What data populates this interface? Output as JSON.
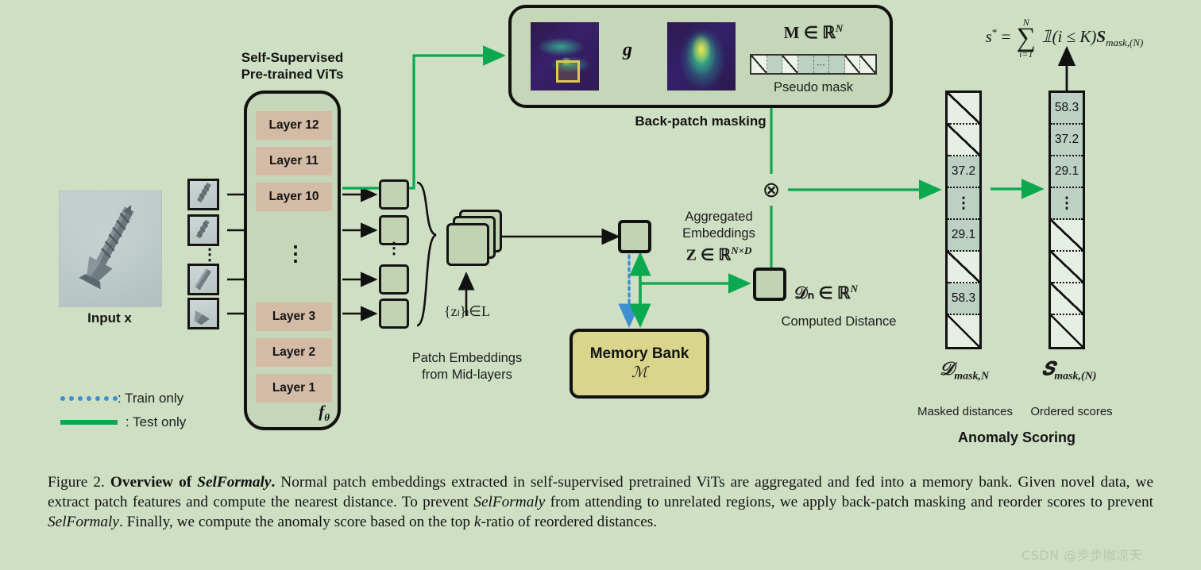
{
  "figure": {
    "background_color": "#cfdfc3",
    "accent_green": "#0aa84f",
    "train_blue": "#3d8fd0",
    "layer_color": "#d3bba6",
    "memory_bank_color": "#d9d68c"
  },
  "input": {
    "label": "Input x",
    "icon": "screw-photo"
  },
  "encoder": {
    "title_line1": "Self-Supervised",
    "title_line2": "Pre-trained ViTs",
    "layers": [
      {
        "label": "Layer 12"
      },
      {
        "label": "Layer 11"
      },
      {
        "label": "Layer 10"
      },
      {
        "label": "Layer 3"
      },
      {
        "label": "Layer 2"
      },
      {
        "label": "Layer 1"
      }
    ],
    "vertical_dots": "⋮",
    "function_symbol": "fθ"
  },
  "patch_embeddings": {
    "set_symbol": "{zₗ}ₗ∈L",
    "caption_line1": "Patch Embeddings",
    "caption_line2": "from Mid-layers"
  },
  "aggregated": {
    "caption_line1": "Aggregated",
    "caption_line2": "Embeddings",
    "math": "Z ∈ ℝ",
    "math_superscript": "N×D"
  },
  "memory_bank": {
    "title": "Memory Bank",
    "symbol": "ℳ"
  },
  "back_patch_masking": {
    "panel_title": "Back-patch masking",
    "transform_symbol": "g",
    "mask_math": "M ∈ ℝ",
    "mask_math_superscript": "N",
    "mask_caption": "Pseudo mask",
    "mask_cells": [
      "hatch",
      "shade",
      "hatch",
      "shade",
      "dots",
      "shade",
      "hatch",
      "hatch"
    ],
    "mask_dots": "⋯",
    "heatmap_left": "feature-heatmap-icon",
    "heatmap_right": "gaussian-heatmap-icon",
    "selection_box": "selected-patch-box"
  },
  "distance": {
    "math": "𝒟ₙ ∈ ℝ",
    "math_superscript": "N",
    "caption": "Computed Distance",
    "operator_symbol": "⊗"
  },
  "anomaly_scoring": {
    "section_title": "Anomaly Scoring",
    "formula": "s* = ∑ 𝟙(i ≤ K)𝑺mask,(N)",
    "formula_parts": {
      "lhs": "s",
      "star": "*",
      "eq": "=",
      "sum": "∑",
      "sum_upper": "N",
      "sum_lower": "i=1",
      "indicator": "𝟙(i ≤ K)",
      "term": "S",
      "term_sub": "mask,(N)"
    },
    "masked": {
      "symbol_main": "𝒟",
      "symbol_sub": "mask,N",
      "caption": "Masked distances",
      "cells": [
        {
          "type": "hatch",
          "value": ""
        },
        {
          "type": "hatch",
          "value": ""
        },
        {
          "type": "shade",
          "value": "37.2"
        },
        {
          "type": "dots",
          "value": "⋮"
        },
        {
          "type": "shade",
          "value": "29.1"
        },
        {
          "type": "hatch",
          "value": ""
        },
        {
          "type": "shade",
          "value": "58.3"
        },
        {
          "type": "hatch",
          "value": ""
        }
      ]
    },
    "ordered": {
      "symbol_main": "𝑺",
      "symbol_sub": "mask,(N)",
      "caption": "Ordered scores",
      "cells": [
        {
          "type": "shade",
          "value": "58.3"
        },
        {
          "type": "shade",
          "value": "37.2"
        },
        {
          "type": "shade",
          "value": "29.1"
        },
        {
          "type": "dots",
          "value": "⋮"
        },
        {
          "type": "hatch",
          "value": ""
        },
        {
          "type": "hatch",
          "value": ""
        },
        {
          "type": "hatch",
          "value": ""
        },
        {
          "type": "hatch",
          "value": ""
        }
      ]
    }
  },
  "legend": {
    "items": [
      {
        "style": "dotted",
        "label": ": Train only",
        "color": "#3d8fd0"
      },
      {
        "style": "solid",
        "label": ": Test only",
        "color": "#0aa84f"
      }
    ]
  },
  "caption": {
    "figure_number": "Figure 2.",
    "title": "Overview of ",
    "title_italic": "SelFormaly",
    "title_period": ".",
    "body_1": " Normal patch embeddings extracted in self-supervised pretrained ViTs are aggregated and fed into a memory bank. Given novel data, we extract patch features and compute the nearest distance. To prevent ",
    "body_em_1": "SelFormaly",
    "body_2": " from attending to unrelated regions, we apply back-patch masking and reorder scores to prevent ",
    "body_em_2": "SelFormaly",
    "body_3": ". Finally, we compute the anomaly score based on the top ",
    "body_em_3": "k",
    "body_4": "-ratio of reordered distances."
  },
  "watermark": {
    "text": "CSDN @步步咖凉天"
  }
}
